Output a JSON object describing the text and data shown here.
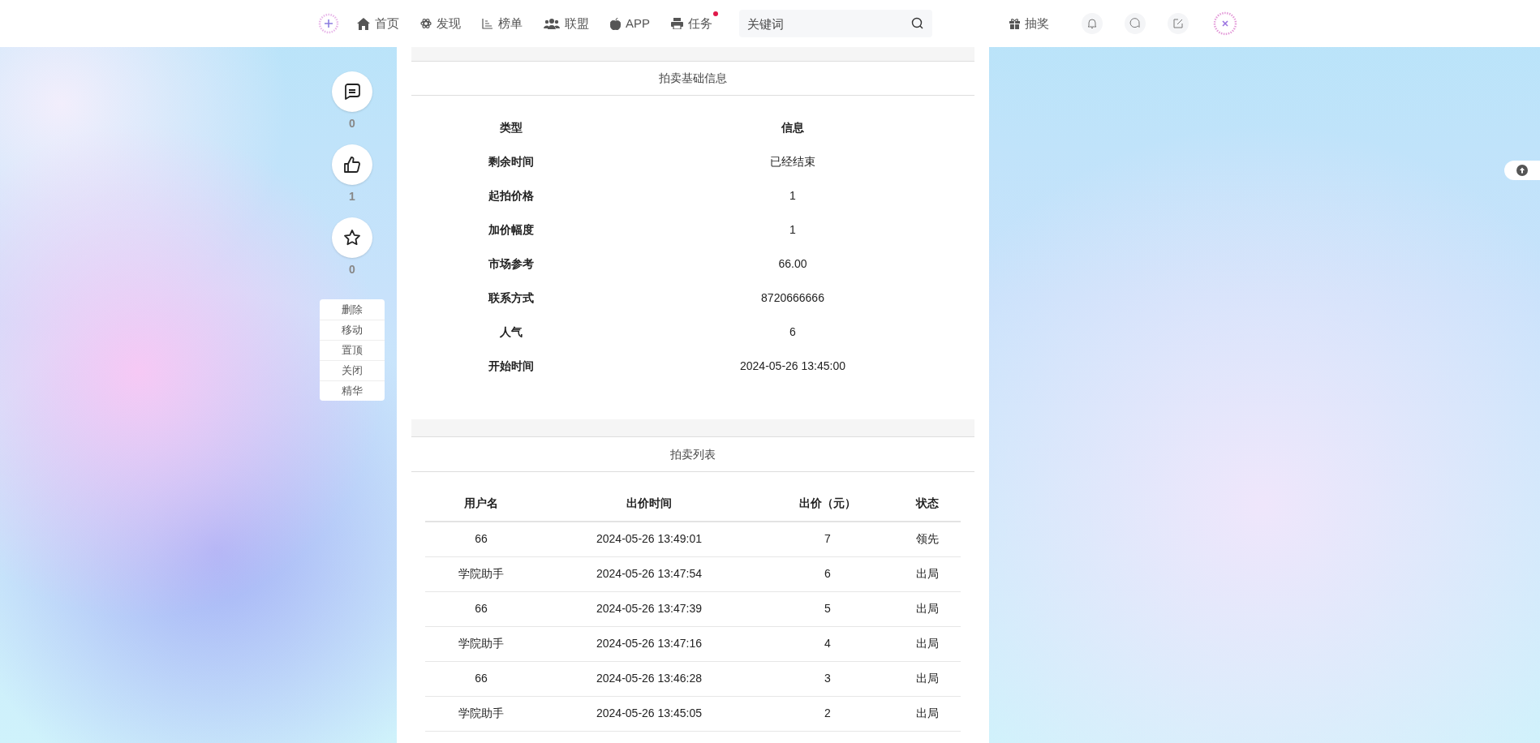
{
  "header": {
    "nav": [
      {
        "kind": "home",
        "label": "首页",
        "badge_dot": false
      },
      {
        "kind": "discover",
        "label": "发现",
        "badge_dot": false
      },
      {
        "kind": "ranking",
        "label": "榜单",
        "badge_dot": false
      },
      {
        "kind": "alliance",
        "label": "联盟",
        "badge_dot": false
      },
      {
        "kind": "app",
        "label": "APP",
        "badge_dot": false
      },
      {
        "kind": "task",
        "label": "任务",
        "badge_dot": true
      }
    ],
    "search": {
      "placeholder": "关键词"
    },
    "lottery": "抽奖"
  },
  "sidebar": {
    "actions": [
      {
        "kind": "comment",
        "count": "0"
      },
      {
        "kind": "like",
        "count": "1"
      },
      {
        "kind": "favorite",
        "count": "0"
      }
    ],
    "admin_menu": [
      "删除",
      "移动",
      "置顶",
      "关闭",
      "精华"
    ]
  },
  "auction_info": {
    "title": "拍卖基础信息",
    "columns": [
      "类型",
      "信息"
    ],
    "rows": [
      [
        "剩余时间",
        "已经结束"
      ],
      [
        "起拍价格",
        "1"
      ],
      [
        "加价幅度",
        "1"
      ],
      [
        "市场参考",
        "66.00"
      ],
      [
        "联系方式",
        "8720666666"
      ],
      [
        "人气",
        "6"
      ],
      [
        "开始时间",
        "2024-05-26 13:45:00"
      ]
    ]
  },
  "bid_list": {
    "title": "拍卖列表",
    "columns": [
      "用户名",
      "出价时间",
      "出价（元）",
      "状态"
    ],
    "rows": [
      [
        "66",
        "2024-05-26 13:49:01",
        "7",
        "领先"
      ],
      [
        "学院助手",
        "2024-05-26 13:47:54",
        "6",
        "出局"
      ],
      [
        "66",
        "2024-05-26 13:47:39",
        "5",
        "出局"
      ],
      [
        "学院助手",
        "2024-05-26 13:47:16",
        "4",
        "出局"
      ],
      [
        "66",
        "2024-05-26 13:46:28",
        "3",
        "出局"
      ],
      [
        "学院助手",
        "2024-05-26 13:45:05",
        "2",
        "出局"
      ]
    ]
  }
}
